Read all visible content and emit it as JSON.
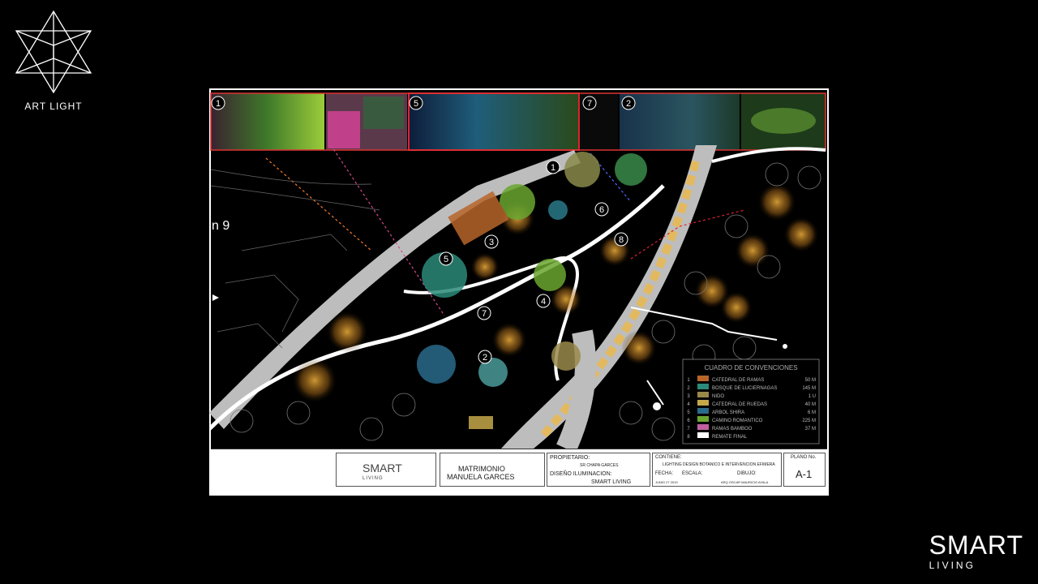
{
  "brand_top_left": {
    "icon": "merkaba-star-icon",
    "label": "ART LIGHT"
  },
  "brand_bottom_right": {
    "title": "SMART",
    "subtitle": "LIVING"
  },
  "plan": {
    "photo_numbers": [
      "1",
      "5",
      "7",
      "2"
    ],
    "map_numbers": [
      "1",
      "6",
      "8",
      "3",
      "5",
      "4",
      "7",
      "2"
    ],
    "edge_label": "n 9",
    "legend_title": "CUADRO DE CONVENCIONES",
    "legend_rows": [
      {
        "num": "1",
        "label": "CATEDRAL DE RAMAS",
        "qty": "50 M"
      },
      {
        "num": "2",
        "label": "BOSQUE DE LUCIERNAGAS",
        "qty": "145 M"
      },
      {
        "num": "3",
        "label": "NIDO",
        "qty": "1 U"
      },
      {
        "num": "4",
        "label": "CATEDRAL DE RUEDAS",
        "qty": "40 M"
      },
      {
        "num": "5",
        "label": "ARBOL SHIRA",
        "qty": "6 M"
      },
      {
        "num": "6",
        "label": "CAMINO ROMANTICO",
        "qty": "225 M"
      },
      {
        "num": "7",
        "label": "RAMAS BAMBOO",
        "qty": "37 M"
      },
      {
        "num": "8",
        "label": "REMATE FINAL",
        "qty": ""
      }
    ],
    "title_block": {
      "logo_title": "SMART",
      "logo_sub": "LIVING",
      "project_line1": "MATRIMONIO",
      "project_line2": "MANUELA GARCES",
      "owner_label": "PROPIETARIO:",
      "owner_value": "SR CHAPA GARCES",
      "design_label": "DISEÑO ILUMINACION:",
      "design_value": "SMART LIVING",
      "contains_label": "CONTIENE:",
      "contains_value": "LIGHTING DESIGN BOTANICO E INTERVENCION EFIMERA",
      "date_label": "FECHA:",
      "date_value": "JUNIO 27 2019",
      "scale_label": "ESCALA:",
      "drawing_label": "DIBUJO:",
      "drawing_value": "ARQ OSCAR MAURICIO AYALA",
      "sheet_label": "PLANO No.",
      "sheet_value": "A-1"
    }
  }
}
